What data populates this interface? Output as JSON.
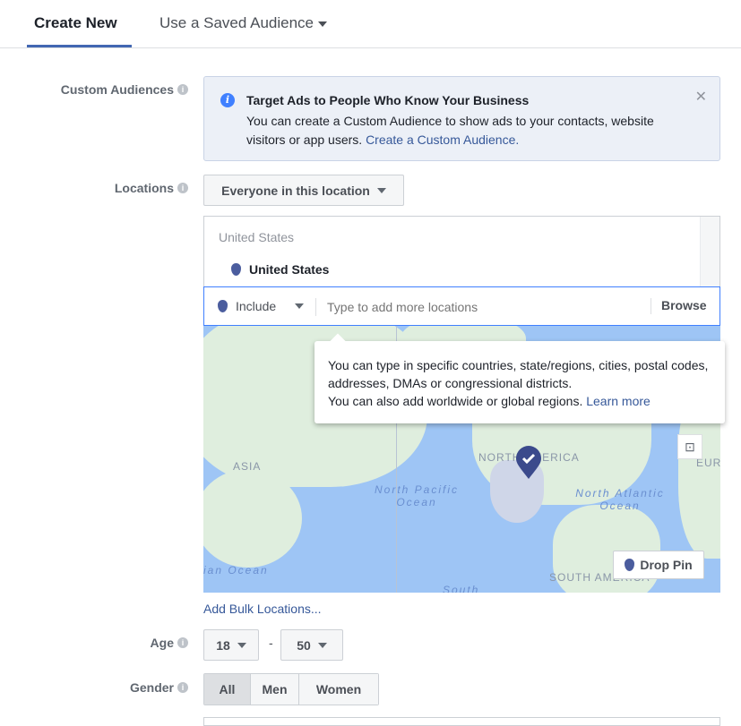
{
  "tabs": {
    "create_new": "Create New",
    "saved_audience": "Use a Saved Audience"
  },
  "custom_audiences": {
    "label": "Custom Audiences",
    "notice_title": "Target Ads to People Who Know Your Business",
    "notice_body": "You can create a Custom Audience to show ads to your contacts, website visitors or app users.",
    "notice_link": "Create a Custom Audience."
  },
  "locations": {
    "label": "Locations",
    "dropdown": "Everyone in this location",
    "group_header": "United States",
    "selected": "United States",
    "include": "Include",
    "placeholder": "Type to add more locations",
    "browse": "Browse",
    "tooltip": "You can type in specific countries, state/regions, cities, postal codes, addresses, DMAs or congressional districts.",
    "tooltip2": "You can also add worldwide or global regions.",
    "tooltip_link": "Learn more",
    "map_labels": {
      "asia": "ASIA",
      "north_america": "NORTH AMERICA",
      "south_america": "SOUTH AMERICA",
      "europe": "EUR",
      "pacific": "North Pacific Ocean",
      "atlantic": "North Atlantic Ocean",
      "indian": "ian Ocean",
      "south": "South"
    },
    "drop_pin": "Drop Pin",
    "bulk": "Add Bulk Locations..."
  },
  "age": {
    "label": "Age",
    "min": "18",
    "max": "50",
    "separator": "-"
  },
  "gender": {
    "label": "Gender",
    "options": [
      "All",
      "Men",
      "Women"
    ],
    "selected": "All"
  }
}
